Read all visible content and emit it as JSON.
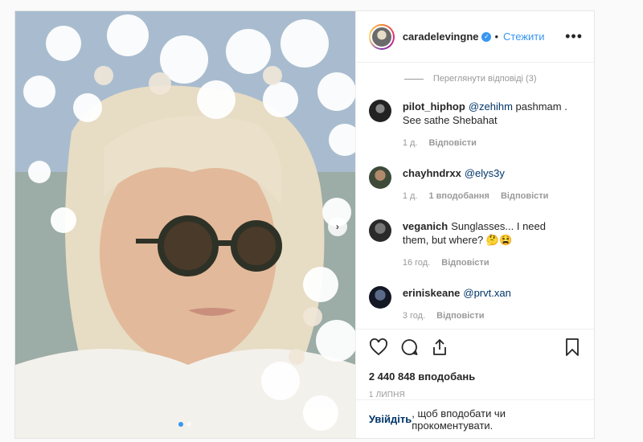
{
  "post": {
    "username": "caradelevingne",
    "verified_icon": "verified-badge-icon",
    "follow_label": "Стежити",
    "more_label": "•••",
    "view_replies": "Переглянути відповіді (3)",
    "comments": [
      {
        "user": "pilot_hiphop",
        "mention": "@zehihm",
        "text": " pashmam . See sathe Shebahat",
        "time": "1 д.",
        "likes": "",
        "reply": "Відповісти",
        "avatar_color": "#2b2b2b"
      },
      {
        "user": "chayhndrxx",
        "mention": "@elys3y",
        "text": "",
        "time": "1 д.",
        "likes": "1 вподобання",
        "reply": "Відповісти",
        "avatar_color": "#6b5b4a"
      },
      {
        "user": "veganich",
        "mention": "",
        "text": "Sunglasses... I need them, but where? 🤔😫",
        "time": "16 год.",
        "likes": "",
        "reply": "Відповісти",
        "avatar_color": "#3a3a3a"
      },
      {
        "user": "eriniskeane",
        "mention": "@prvt.xan",
        "text": "",
        "time": "3 год.",
        "likes": "",
        "reply": "Відповісти",
        "avatar_color": "#1f2430"
      }
    ],
    "likes_count": "2 440 848 вподобань",
    "date": "1 липня",
    "login_link": "Увійдіть",
    "login_text": ", щоб вподобати чи прокоментувати.",
    "carousel": {
      "slides": 2,
      "active": 0
    },
    "icons": [
      "heart-icon",
      "comment-icon",
      "share-icon",
      "bookmark-icon",
      "chevron-right-icon"
    ],
    "colors": {
      "link": "#003569",
      "accent": "#3897f0",
      "muted": "#999999"
    }
  }
}
